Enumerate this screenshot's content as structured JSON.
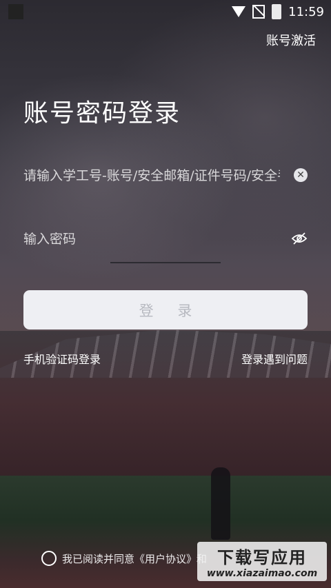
{
  "status_bar": {
    "time": "11:59",
    "icons": [
      "wifi-icon",
      "no-signal-icon",
      "battery-charging-icon"
    ]
  },
  "header": {
    "activate_label": "账号激活"
  },
  "login": {
    "title": "账号密码登录",
    "account_placeholder": "请输入学工号-账号/安全邮箱/证件号码/安全手机号",
    "password_placeholder": "输入密码",
    "login_button": "登 录",
    "sms_login": "手机验证码登录",
    "trouble": "登录遇到问题"
  },
  "agreement": {
    "text": "我已阅读并同意《用户协议》和"
  },
  "watermark": {
    "title": "下载写应用",
    "url": "www.xiazaimao.com"
  },
  "colors": {
    "button_bg": "#eeeff3",
    "button_text": "#b7b9c0"
  }
}
